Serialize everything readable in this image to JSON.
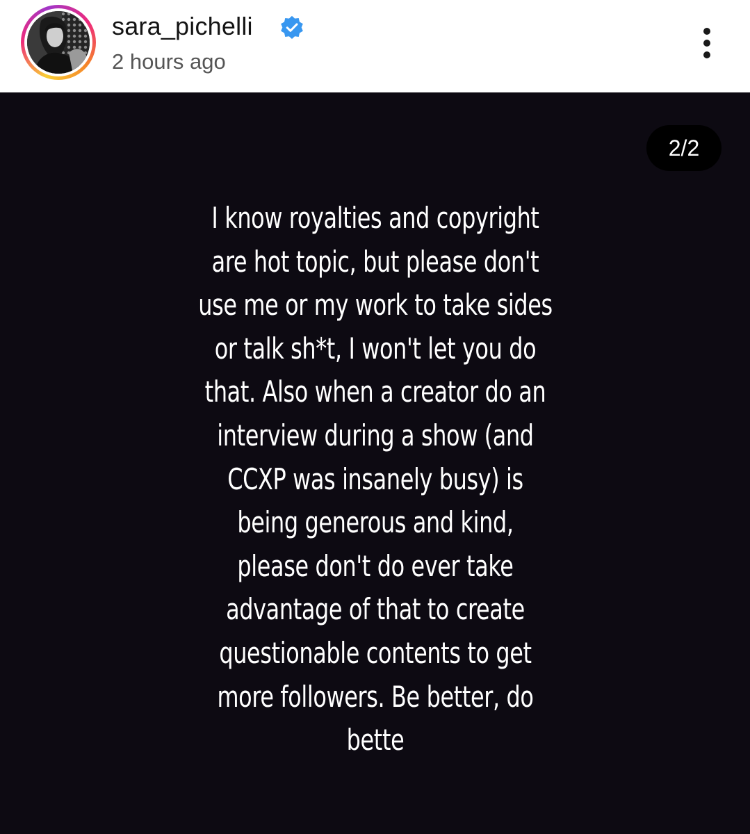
{
  "post": {
    "username": "sara_pichelli",
    "timestamp": "2 hours ago",
    "verified_icon": "verified-badge-icon",
    "more_icon": "more-vertical-icon"
  },
  "story": {
    "counter": "2/2",
    "lines": [
      "I know royalties and copyright",
      "are hot topic, but please don't",
      "use me or my work to take sides",
      "or talk sh*t, I won't let you do",
      "that. Also when a creator do an",
      "interview during a show (and",
      "CCXP was insanely busy) is",
      "being generous and kind,",
      "please don't do ever take",
      "advantage of that to create",
      "questionable contents to get",
      "more followers. Be better, do",
      "bette"
    ]
  },
  "colors": {
    "header_bg": "#ffffff",
    "story_bg": "#0d0a12",
    "verified_blue": "#3897f0",
    "text_primary": "#141414",
    "text_secondary": "#555555"
  }
}
